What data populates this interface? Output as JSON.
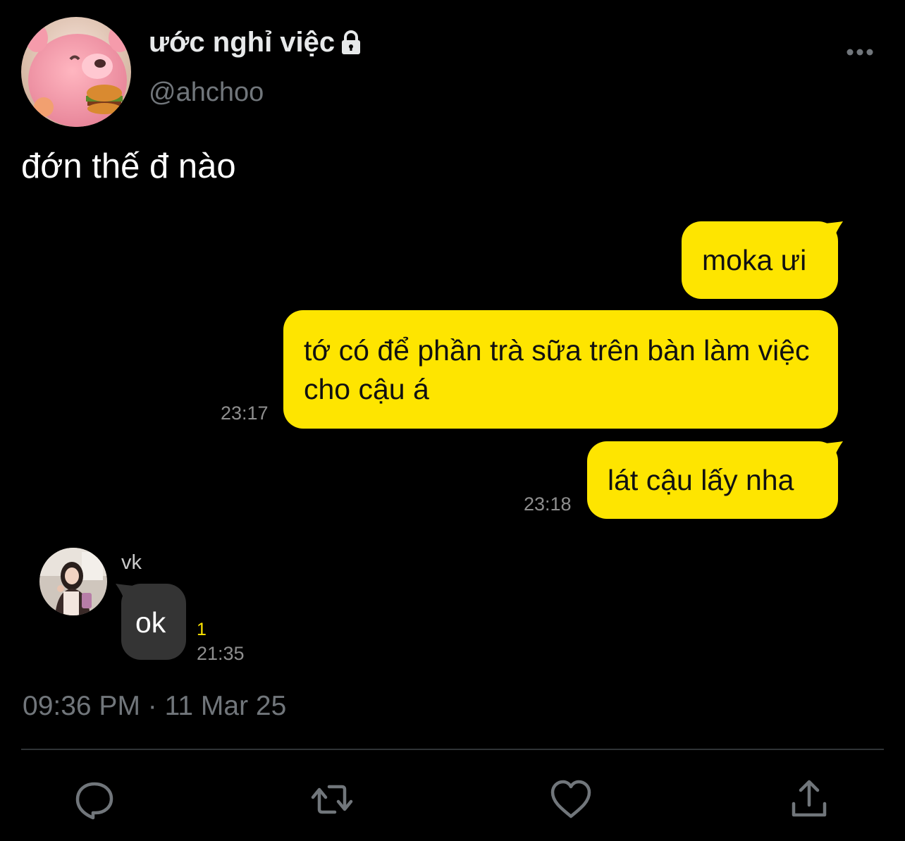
{
  "author": {
    "display_name": "ước nghỉ việc",
    "handle": "@ahchoo",
    "protected_icon": "lock-icon"
  },
  "tweet": {
    "text": "đớn thế đ nào",
    "timestamp": "09:36 PM · 11 Mar 25"
  },
  "chat": {
    "outgoing": [
      {
        "text": "moka ưi",
        "time": ""
      },
      {
        "text": "tớ có để phần trà sữa trên bàn làm việc cho cậu á",
        "time": "23:17"
      },
      {
        "text": "lát cậu lấy nha",
        "time": "23:18"
      }
    ],
    "incoming": {
      "sender": "vk",
      "text": "ok",
      "unread": "1",
      "time": "21:35"
    },
    "colors": {
      "outgoing_bubble": "#fee500",
      "incoming_bubble": "#343434"
    }
  },
  "actions": {
    "icons": [
      "reply-icon",
      "retweet-icon",
      "like-icon",
      "share-icon"
    ]
  },
  "colors": {
    "background": "#000000",
    "secondary_text": "#71767b"
  }
}
